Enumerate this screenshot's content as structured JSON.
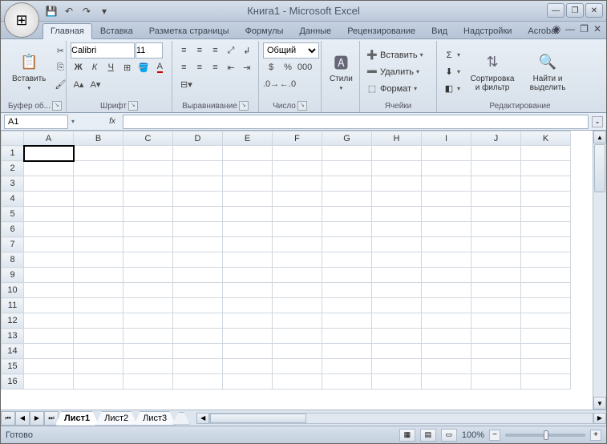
{
  "title": "Книга1 - Microsoft Excel",
  "qat": {
    "save": "💾",
    "undo": "↶",
    "redo": "↷"
  },
  "tabs": [
    "Главная",
    "Вставка",
    "Разметка страницы",
    "Формулы",
    "Данные",
    "Рецензирование",
    "Вид",
    "Надстройки",
    "Acrobat"
  ],
  "active_tab": 0,
  "ribbon": {
    "clipboard": {
      "paste": "Вставить",
      "label": "Буфер об..."
    },
    "font": {
      "name": "Calibri",
      "size": "11",
      "bold": "Ж",
      "italic": "К",
      "underline": "Ч",
      "label": "Шрифт"
    },
    "alignment": {
      "label": "Выравнивание"
    },
    "number": {
      "format": "Общий",
      "label": "Число"
    },
    "styles": {
      "btn": "Стили"
    },
    "cells": {
      "insert": "Вставить",
      "delete": "Удалить",
      "format": "Формат",
      "label": "Ячейки"
    },
    "editing": {
      "sort": "Сортировка и фильтр",
      "find": "Найти и выделить",
      "label": "Редактирование"
    }
  },
  "namebox": "A1",
  "formula": "",
  "columns": [
    "A",
    "B",
    "C",
    "D",
    "E",
    "F",
    "G",
    "H",
    "I",
    "J",
    "K"
  ],
  "rows": [
    1,
    2,
    3,
    4,
    5,
    6,
    7,
    8,
    9,
    10,
    11,
    12,
    13,
    14,
    15,
    16
  ],
  "selected_cell": "A1",
  "sheet_tabs": [
    "Лист1",
    "Лист2",
    "Лист3"
  ],
  "active_sheet": 0,
  "status": {
    "ready": "Готово",
    "zoom": "100%"
  }
}
